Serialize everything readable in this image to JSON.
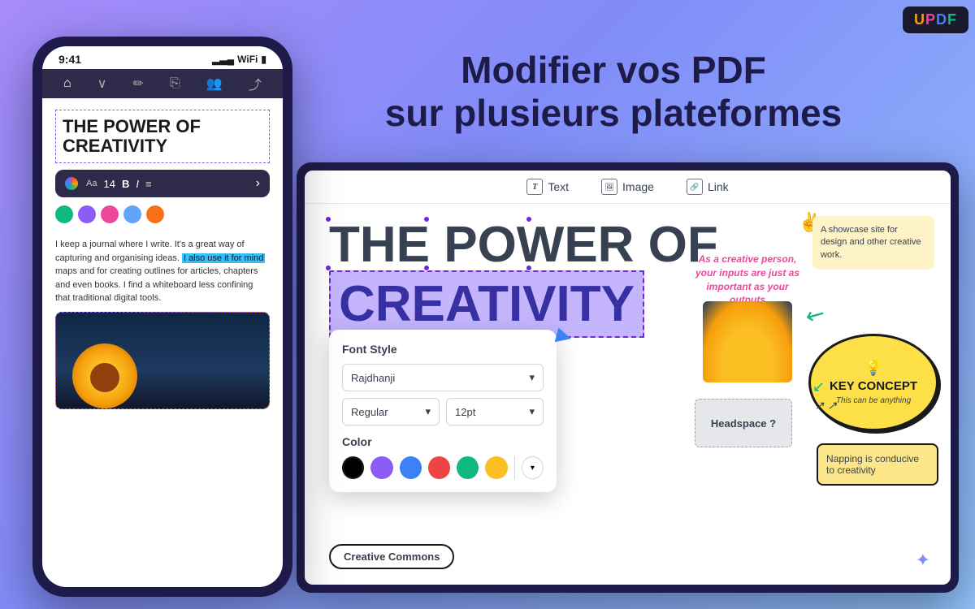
{
  "app": {
    "logo": "UPDF",
    "logo_letters": [
      "U",
      "P",
      "D",
      "F"
    ]
  },
  "header": {
    "line1": "Modifier vos PDF",
    "line2": "sur plusieurs plateformes"
  },
  "phone": {
    "time": "9:41",
    "title": "THE POWER OF\nCREATIVITY",
    "format_bar": {
      "font": "Aa",
      "size": "14",
      "bold": "B",
      "italic": "I"
    },
    "body_text": "I keep a journal where I write. It's a great way of capturing and organising ideas.",
    "highlight_text": "I also use it for mind",
    "body_text2": "maps and for creating outlines for articles, chapters and even books. I find a whiteboard less confining that traditional digital tools."
  },
  "toolbar": {
    "items": [
      {
        "icon": "T",
        "label": "Text"
      },
      {
        "icon": "img",
        "label": "Image"
      },
      {
        "icon": "link",
        "label": "Link"
      }
    ]
  },
  "document": {
    "title_line1": "THE POWER OF",
    "title_line2": "CREATIVITY",
    "creative_quote": "As a creative person, your inputs are just as important as your outputs",
    "showcase_text": "A showcase site for design and other creative work.",
    "key_concept_title": "KEY CONCEPT",
    "key_concept_sub": "This can be anything",
    "headspace_label": "Headspace ?",
    "napping_text": "Napping is conducive to creativity"
  },
  "font_panel": {
    "title": "Font Style",
    "font_name": "Rajdhanji",
    "style": "Regular",
    "size": "12pt",
    "color_label": "Color",
    "colors": [
      "#000000",
      "#8b5cf6",
      "#3b82f6",
      "#ef4444",
      "#10b981",
      "#fbbf24"
    ],
    "chevron": "▾"
  },
  "creative_commons": {
    "label": "Creative Commons"
  }
}
